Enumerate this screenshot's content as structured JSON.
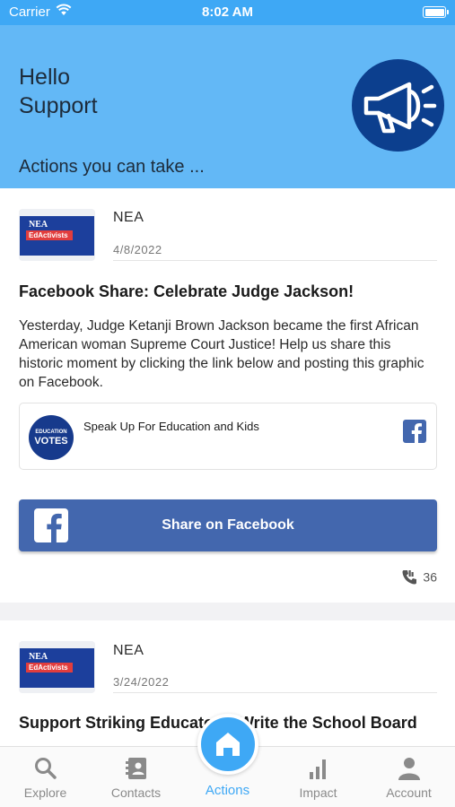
{
  "status_bar": {
    "carrier": "Carrier",
    "time": "8:02 AM"
  },
  "header": {
    "greeting_line1": "Hello",
    "greeting_line2": "Support",
    "section_title": "Actions you can take ...",
    "icon": "megaphone-icon"
  },
  "posts": [
    {
      "org": "NEA",
      "logo_text": {
        "nea": "NEA",
        "tag": "EdActivists"
      },
      "date": "4/8/2022",
      "title": "Facebook Share: Celebrate Judge Jackson!",
      "body": "Yesterday, Judge Ketanji Brown Jackson became the first African American woman Supreme Court Justice! Help us share this historic moment by clicking the link below and posting this graphic on Facebook.",
      "link_card": {
        "logo_line1": "EDUCATION",
        "logo_line2": "VOTES",
        "title": "Speak Up For Education and Kids",
        "icon": "facebook-icon"
      },
      "share_label": "Share on Facebook",
      "action_count": "36"
    },
    {
      "org": "NEA",
      "logo_text": {
        "nea": "NEA",
        "tag": "EdActivists"
      },
      "date": "3/24/2022",
      "title": "Support Striking Educators: Write the School Board"
    }
  ],
  "tabs": [
    {
      "label": "Explore",
      "icon": "search-icon"
    },
    {
      "label": "Contacts",
      "icon": "contacts-icon"
    },
    {
      "label": "Actions",
      "icon": "home-icon"
    },
    {
      "label": "Impact",
      "icon": "bar-chart-icon"
    },
    {
      "label": "Account",
      "icon": "person-icon"
    }
  ],
  "colors": {
    "header": "#63b8f6",
    "accent": "#3ea8f5",
    "facebook": "#4367ae",
    "megaphone_bg": "#0c3f8e"
  }
}
